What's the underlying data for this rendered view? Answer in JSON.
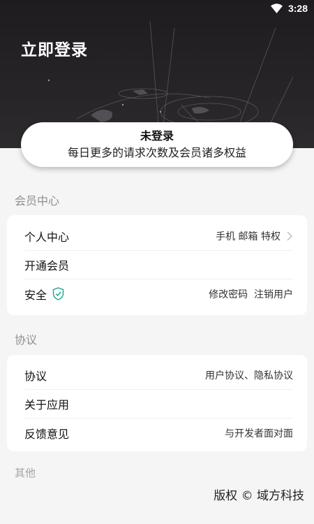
{
  "status": {
    "time": "3:28"
  },
  "header": {
    "title": "立即登录"
  },
  "login_card": {
    "status": "未登录",
    "promo": "每日更多的请求次数及会员诸多权益"
  },
  "sections": {
    "member": {
      "title": "会员中心",
      "rows": [
        {
          "label": "个人中心",
          "value": "手机 邮箱 特权"
        },
        {
          "label": "开通会员",
          "value": ""
        },
        {
          "label": "安全",
          "value": "修改密码  注销用户"
        }
      ]
    },
    "agreement": {
      "title": "协议",
      "rows": [
        {
          "label": "协议",
          "value": "用户协议、隐私协议"
        },
        {
          "label": "关于应用",
          "value": ""
        },
        {
          "label": "反馈意见",
          "value": "与开发者面对面"
        }
      ]
    },
    "other": {
      "title": "其他"
    }
  },
  "footer": {
    "copyright": "版权 © 域方科技"
  },
  "colors": {
    "accent_shield": "#1aa58c",
    "hero_bg": "#252326",
    "section_title": "#8f8f8f"
  }
}
